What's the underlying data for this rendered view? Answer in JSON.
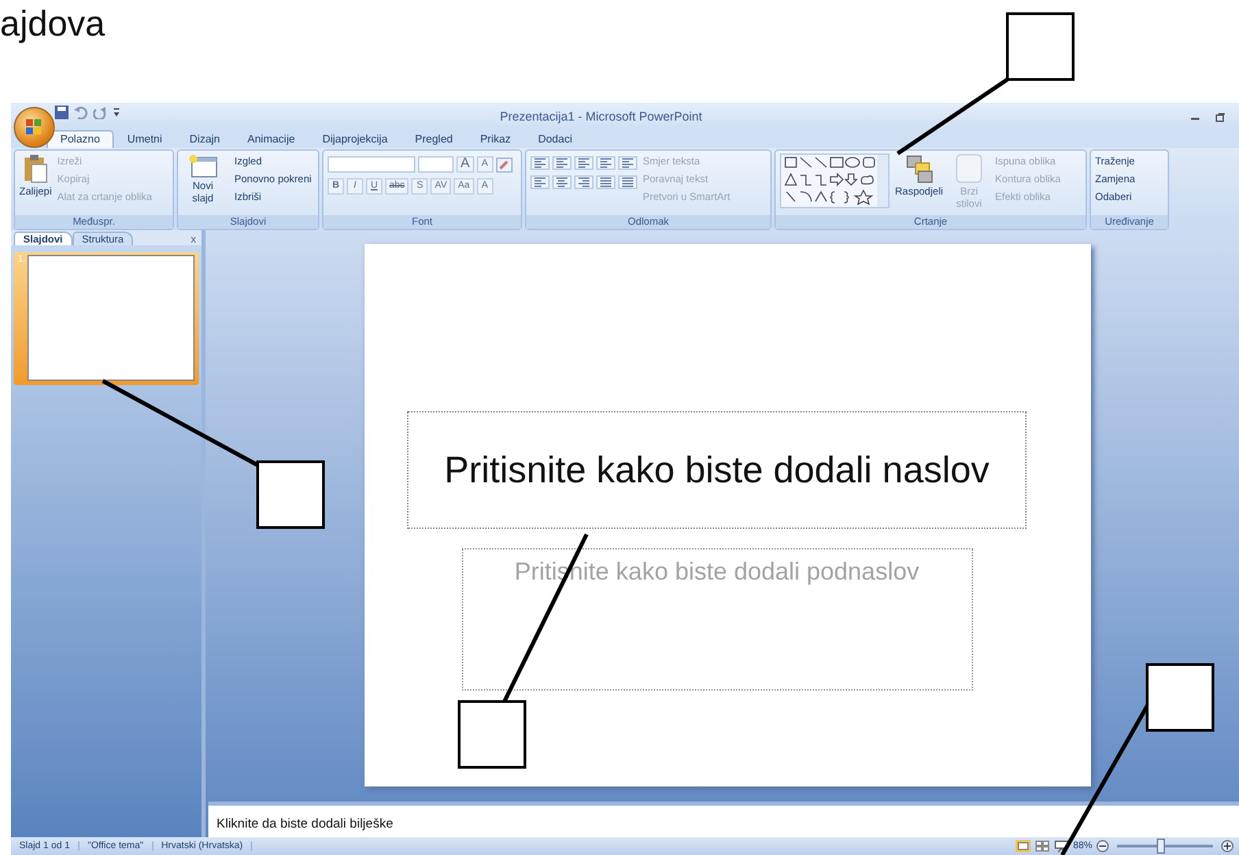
{
  "heading": "ajdova",
  "window": {
    "title": "Prezentacija1 - Microsoft PowerPoint"
  },
  "tabs": [
    {
      "label": "Polazno",
      "selected": true
    },
    {
      "label": "Umetni",
      "selected": false
    },
    {
      "label": "Dizajn",
      "selected": false
    },
    {
      "label": "Animacije",
      "selected": false
    },
    {
      "label": "Dijaprojekcija",
      "selected": false
    },
    {
      "label": "Pregled",
      "selected": false
    },
    {
      "label": "Prikaz",
      "selected": false
    },
    {
      "label": "Dodaci",
      "selected": false
    }
  ],
  "ribbon": {
    "clipboard": {
      "label": "Međuspr.",
      "paste": "Zalijepi",
      "items": [
        {
          "label": "Izreži",
          "disabled": true
        },
        {
          "label": "Kopiraj",
          "disabled": true
        },
        {
          "label": "Alat za crtanje oblika",
          "disabled": true
        }
      ]
    },
    "slides": {
      "label": "Slajdovi",
      "new_slide": "Novi slajd",
      "items": [
        {
          "label": "Izgled",
          "disabled": false
        },
        {
          "label": "Ponovno pokreni",
          "disabled": false
        },
        {
          "label": "Izbriši",
          "disabled": false
        }
      ]
    },
    "font": {
      "label": "Font",
      "grow": "A",
      "shrink": "A",
      "buttons": [
        "B",
        "I",
        "U",
        "abc",
        "S",
        "AV",
        "Aa",
        "A"
      ]
    },
    "paragraph": {
      "label": "Odlomak",
      "items": [
        {
          "label": "Smjer teksta",
          "disabled": true
        },
        {
          "label": "Poravnaj tekst",
          "disabled": true
        },
        {
          "label": "Pretvori u SmartArt",
          "disabled": true
        }
      ]
    },
    "drawing": {
      "label": "Crtanje",
      "arrange": "Raspodjeli",
      "quick_styles": "Brzi stilovi",
      "items": [
        {
          "label": "Ispuna oblika",
          "disabled": true
        },
        {
          "label": "Kontura oblika",
          "disabled": true
        },
        {
          "label": "Efekti oblika",
          "disabled": true
        }
      ]
    },
    "editing": {
      "label": "Uređivanje",
      "items": [
        {
          "label": "Traženje",
          "disabled": false
        },
        {
          "label": "Zamjena",
          "disabled": false
        },
        {
          "label": "Odaberi",
          "disabled": false
        }
      ]
    }
  },
  "side_panel": {
    "tabs": [
      {
        "label": "Slajdovi",
        "selected": true
      },
      {
        "label": "Struktura",
        "selected": false
      }
    ],
    "close": "x",
    "thumbnails": [
      {
        "number": "1",
        "selected": true
      }
    ]
  },
  "slide": {
    "title_placeholder": "Pritisnite kako biste dodali naslov",
    "subtitle_placeholder": "Pritisnite kako biste dodali podnaslov"
  },
  "notes": {
    "placeholder": "Kliknite da biste dodali bilješke"
  },
  "status_bar": {
    "items": [
      "Slajd 1 od 1",
      "\"Office tema\"",
      "Hrvatski (Hrvatska)"
    ],
    "zoom": {
      "reading": "88%",
      "level": 0.45
    }
  }
}
